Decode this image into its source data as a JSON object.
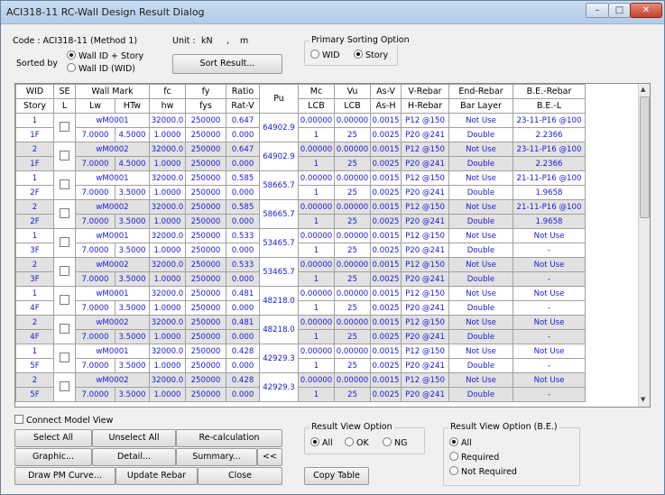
{
  "title": "ACI318-11 RC-Wall Design Result Dialog",
  "window_buttons": {
    "min": "–",
    "max": "□",
    "close": "✕"
  },
  "code_label": "Code : ACI318-11 (Method 1)",
  "unit_label": "Unit :",
  "unit_force": "kN",
  "unit_comma": ",",
  "unit_length": "m",
  "sorted_by_label": "Sorted by",
  "sort_opt1": "Wall ID + Story",
  "sort_opt2": "Wall ID (WID)",
  "sort_result_button": "Sort Result...",
  "primary_sorting": {
    "title": "Primary Sorting Option",
    "wid": "WID",
    "story": "Story"
  },
  "table": {
    "h1": {
      "wid": "WID",
      "se": "SE",
      "wallmark": "Wall Mark",
      "fc": "fc",
      "fy": "fy",
      "ratio": "Ratio",
      "pu": "Pu",
      "mc": "Mc",
      "vu": "Vu",
      "asv": "As-V",
      "vrebar": "V-Rebar",
      "endrebar": "End-Rebar",
      "berebar": "B.E.-Rebar"
    },
    "h2": {
      "story": "Story",
      "l": "L",
      "lw": "Lw",
      "htw": "HTw",
      "hw": "hw",
      "fys": "fys",
      "ratv": "Rat-V",
      "lcb1": "LCB",
      "lcb2": "LCB",
      "ash": "As-H",
      "hrebar": "H-Rebar",
      "barlayer": "Bar Layer",
      "bel": "B.E.-L"
    },
    "rows": [
      {
        "wid": "1",
        "mark": "wM0001",
        "fc": "32000.0",
        "fy": "250000",
        "ratio": "0.647",
        "pu": "64902.9",
        "mc": "0.00000",
        "vu": "0.00000",
        "asv": "0.0015",
        "vrebar": "P12 @150",
        "end": "Not Use",
        "be": "23-11-P16 @100",
        "story": "1F",
        "lw": "7.0000",
        "htw": "4.5000",
        "hw": "1.0000",
        "fys": "250000",
        "ratv": "0.000",
        "lcb1": "1",
        "lcb2": "25",
        "ash": "0.0025",
        "hrebar": "P20 @241",
        "layer": "Double",
        "bel": "2.2366"
      },
      {
        "wid": "2",
        "mark": "wM0002",
        "fc": "32000.0",
        "fy": "250000",
        "ratio": "0.647",
        "pu": "64902.9",
        "mc": "0.00000",
        "vu": "0.00000",
        "asv": "0.0015",
        "vrebar": "P12 @150",
        "end": "Not Use",
        "be": "23-11-P16 @100",
        "story": "1F",
        "lw": "7.0000",
        "htw": "4.5000",
        "hw": "1.0000",
        "fys": "250000",
        "ratv": "0.000",
        "lcb1": "1",
        "lcb2": "25",
        "ash": "0.0025",
        "hrebar": "P20 @241",
        "layer": "Double",
        "bel": "2.2366"
      },
      {
        "wid": "1",
        "mark": "wM0001",
        "fc": "32000.0",
        "fy": "250000",
        "ratio": "0.585",
        "pu": "58665.7",
        "mc": "0.00000",
        "vu": "0.00000",
        "asv": "0.0015",
        "vrebar": "P12 @150",
        "end": "Not Use",
        "be": "21-11-P16 @100",
        "story": "2F",
        "lw": "7.0000",
        "htw": "3.5000",
        "hw": "1.0000",
        "fys": "250000",
        "ratv": "0.000",
        "lcb1": "1",
        "lcb2": "25",
        "ash": "0.0025",
        "hrebar": "P20 @241",
        "layer": "Double",
        "bel": "1.9658"
      },
      {
        "wid": "2",
        "mark": "wM0002",
        "fc": "32000.0",
        "fy": "250000",
        "ratio": "0.585",
        "pu": "58665.7",
        "mc": "0.00000",
        "vu": "0.00000",
        "asv": "0.0015",
        "vrebar": "P12 @150",
        "end": "Not Use",
        "be": "21-11-P16 @100",
        "story": "2F",
        "lw": "7.0000",
        "htw": "3.5000",
        "hw": "1.0000",
        "fys": "250000",
        "ratv": "0.000",
        "lcb1": "1",
        "lcb2": "25",
        "ash": "0.0025",
        "hrebar": "P20 @241",
        "layer": "Double",
        "bel": "1.9658"
      },
      {
        "wid": "1",
        "mark": "wM0001",
        "fc": "32000.0",
        "fy": "250000",
        "ratio": "0.533",
        "pu": "53465.7",
        "mc": "0.00000",
        "vu": "0.00000",
        "asv": "0.0015",
        "vrebar": "P12 @150",
        "end": "Not Use",
        "be": "Not Use",
        "story": "3F",
        "lw": "7.0000",
        "htw": "3.5000",
        "hw": "1.0000",
        "fys": "250000",
        "ratv": "0.000",
        "lcb1": "1",
        "lcb2": "25",
        "ash": "0.0025",
        "hrebar": "P20 @241",
        "layer": "Double",
        "bel": "-"
      },
      {
        "wid": "2",
        "mark": "wM0002",
        "fc": "32000.0",
        "fy": "250000",
        "ratio": "0.533",
        "pu": "53465.7",
        "mc": "0.00000",
        "vu": "0.00000",
        "asv": "0.0015",
        "vrebar": "P12 @150",
        "end": "Not Use",
        "be": "Not Use",
        "story": "3F",
        "lw": "7.0000",
        "htw": "3.5000",
        "hw": "1.0000",
        "fys": "250000",
        "ratv": "0.000",
        "lcb1": "1",
        "lcb2": "25",
        "ash": "0.0025",
        "hrebar": "P20 @241",
        "layer": "Double",
        "bel": "-"
      },
      {
        "wid": "1",
        "mark": "wM0001",
        "fc": "32000.0",
        "fy": "250000",
        "ratio": "0.481",
        "pu": "48218.0",
        "mc": "0.00000",
        "vu": "0.00000",
        "asv": "0.0015",
        "vrebar": "P12 @150",
        "end": "Not Use",
        "be": "Not Use",
        "story": "4F",
        "lw": "7.0000",
        "htw": "3.5000",
        "hw": "1.0000",
        "fys": "250000",
        "ratv": "0.000",
        "lcb1": "1",
        "lcb2": "25",
        "ash": "0.0025",
        "hrebar": "P20 @241",
        "layer": "Double",
        "bel": "-"
      },
      {
        "wid": "2",
        "mark": "wM0002",
        "fc": "32000.0",
        "fy": "250000",
        "ratio": "0.481",
        "pu": "48218.0",
        "mc": "0.00000",
        "vu": "0.00000",
        "asv": "0.0015",
        "vrebar": "P12 @150",
        "end": "Not Use",
        "be": "Not Use",
        "story": "4F",
        "lw": "7.0000",
        "htw": "3.5000",
        "hw": "1.0000",
        "fys": "250000",
        "ratv": "0.000",
        "lcb1": "1",
        "lcb2": "25",
        "ash": "0.0025",
        "hrebar": "P20 @241",
        "layer": "Double",
        "bel": "-"
      },
      {
        "wid": "1",
        "mark": "wM0001",
        "fc": "32000.0",
        "fy": "250000",
        "ratio": "0.428",
        "pu": "42929.3",
        "mc": "0.00000",
        "vu": "0.00000",
        "asv": "0.0015",
        "vrebar": "P12 @150",
        "end": "Not Use",
        "be": "Not Use",
        "story": "5F",
        "lw": "7.0000",
        "htw": "3.5000",
        "hw": "1.0000",
        "fys": "250000",
        "ratv": "0.000",
        "lcb1": "1",
        "lcb2": "25",
        "ash": "0.0025",
        "hrebar": "P20 @241",
        "layer": "Double",
        "bel": "-"
      },
      {
        "wid": "2",
        "mark": "wM0002",
        "fc": "32000.0",
        "fy": "250000",
        "ratio": "0.428",
        "pu": "42929.3",
        "mc": "0.00000",
        "vu": "0.00000",
        "asv": "0.0015",
        "vrebar": "P12 @150",
        "end": "Not Use",
        "be": "Not Use",
        "story": "5F",
        "lw": "7.0000",
        "htw": "3.5000",
        "hw": "1.0000",
        "fys": "250000",
        "ratv": "0.000",
        "lcb1": "1",
        "lcb2": "25",
        "ash": "0.0025",
        "hrebar": "P20 @241",
        "layer": "Double",
        "bel": "-"
      }
    ]
  },
  "connect_model_view": "Connect Model View",
  "buttons": {
    "select_all": "Select All",
    "unselect_all": "Unselect All",
    "recalc": "Re-calculation",
    "graphic": "Graphic...",
    "detail": "Detail...",
    "summary": "Summary...",
    "collapse": "<<",
    "draw_pm": "Draw PM Curve...",
    "update_rebar": "Update Rebar",
    "close": "Close",
    "copy_table": "Copy Table"
  },
  "result_view": {
    "title": "Result View Option",
    "all": "All",
    "ok": "OK",
    "ng": "NG"
  },
  "result_view_be": {
    "title": "Result View Option (B.E.)",
    "all": "All",
    "required": "Required",
    "not_required": "Not Required"
  },
  "colors": {
    "text_blue": "#1a1ad6",
    "shade": "#e2e2e2",
    "titlebar": "#c9dcf2",
    "close_red": "#c5402a"
  }
}
